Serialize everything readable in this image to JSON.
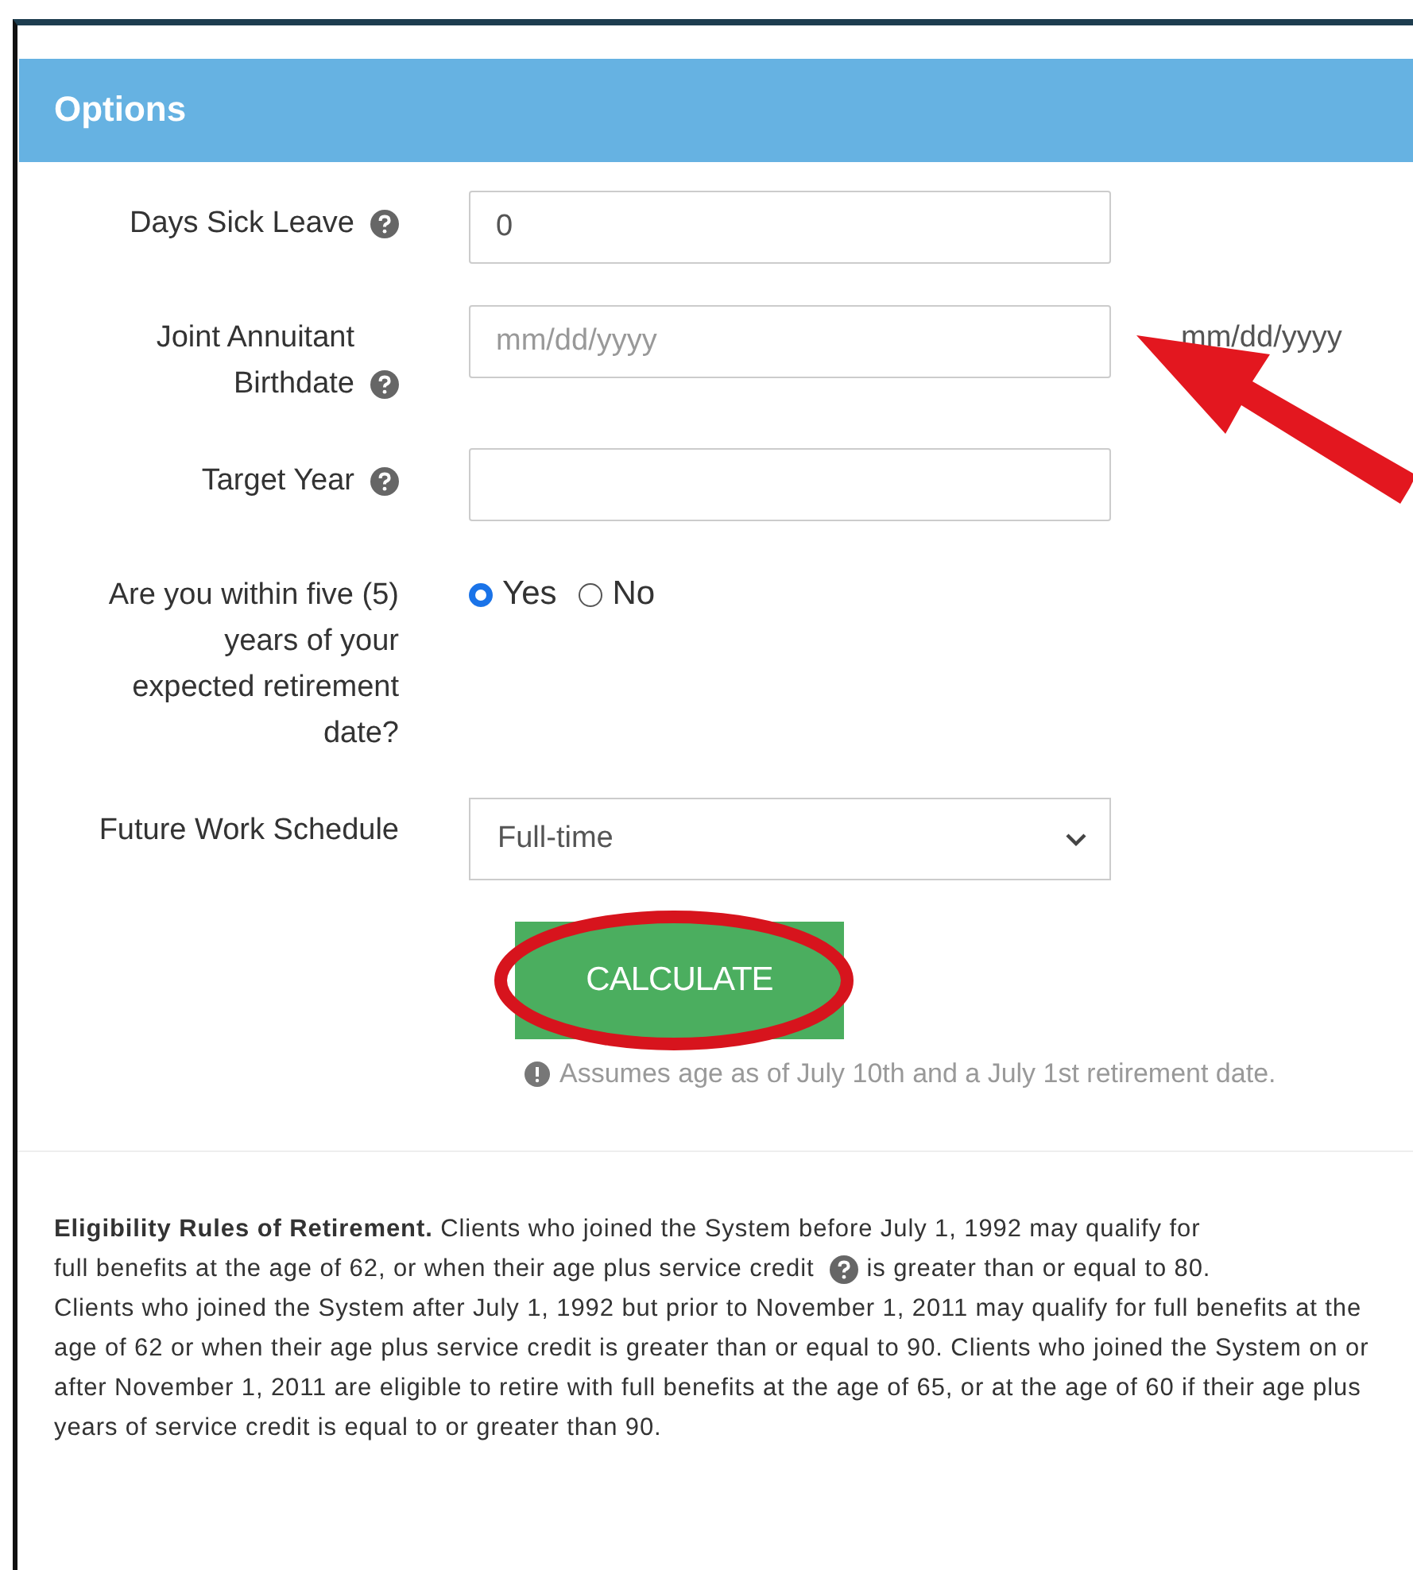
{
  "panel": {
    "title": "Options"
  },
  "fields": [
    {
      "kind": "text",
      "label": "Days Sick Leave",
      "help": true,
      "value": "0"
    },
    {
      "kind": "text",
      "label": "Joint Annuitant Birthdate",
      "help": true,
      "placeholder": "mm/dd/yyyy",
      "hint": "mm/dd/yyyy"
    },
    {
      "kind": "text",
      "label": "Target Year",
      "help": true
    },
    {
      "kind": "radio",
      "label": "Are you within five (5) years of your expected retirement date?",
      "help": false,
      "options": [
        {
          "label": "Yes",
          "selected": true
        },
        {
          "label": "No",
          "selected": false
        }
      ]
    },
    {
      "kind": "select",
      "label": "Future Work Schedule",
      "help": false,
      "value": "Full-time"
    }
  ],
  "button": {
    "label": "CALCULATE"
  },
  "note": "Assumes age as of July 10th and a July 1st retirement date.",
  "rules": {
    "lead": "**Eligibility Rules of Retirement.** Clients who joined the System before July 1, 1992 may qualify for",
    "before_help": "full benefits at the age of 62, or when their age plus service credit",
    "after_help": "is greater than or equal to 80.",
    "rest": "Clients who joined the System after July 1, 1992 but prior to November 1, 2011 may qualify for full benefits at the age of 62 or when their age plus service credit is greater than or equal to 90. Clients who joined the System on or after November 1, 2011 are eligible to retire with full benefits at the age of 65, or at the age of 60 if their age plus years of service credit is equal to or greater than 90."
  }
}
